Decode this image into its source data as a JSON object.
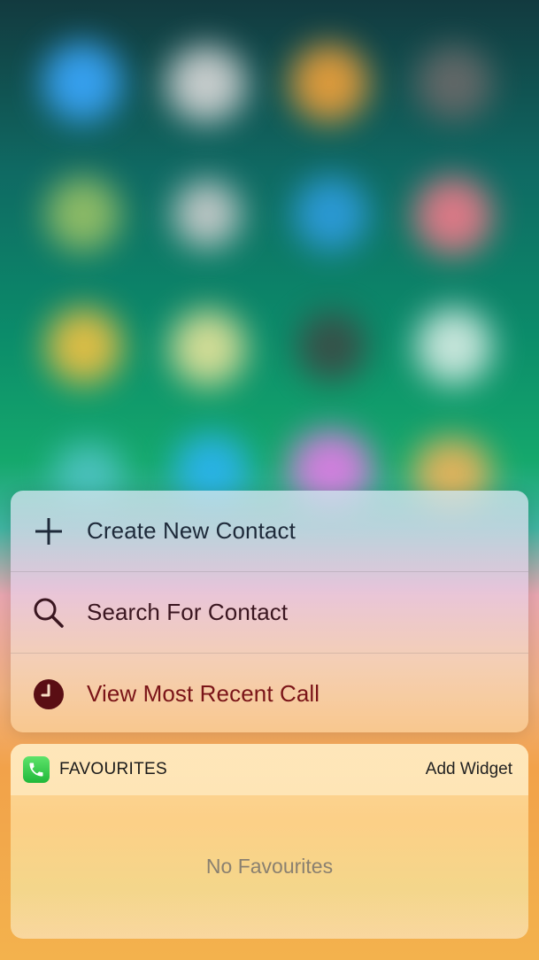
{
  "menu": {
    "items": [
      {
        "label": "Create New Contact",
        "icon": "plus-icon",
        "color": "#1e2a3a"
      },
      {
        "label": "Search For Contact",
        "icon": "search-icon",
        "color": "#3a1620"
      },
      {
        "label": "View Most Recent Call",
        "icon": "clock-icon",
        "color": "#7a1418"
      }
    ]
  },
  "widget": {
    "app_icon": "phone-icon",
    "title": "FAVOURITES",
    "action_label": "Add Widget",
    "empty_text": "No Favourites"
  }
}
